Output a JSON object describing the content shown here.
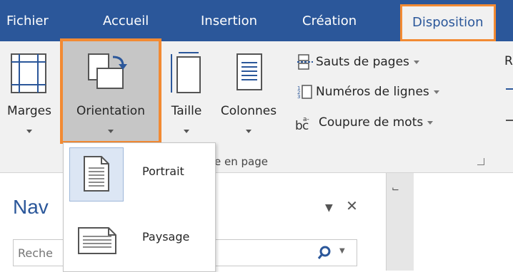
{
  "tabs": [
    {
      "label": "Fichier"
    },
    {
      "label": "Accueil"
    },
    {
      "label": "Insertion"
    },
    {
      "label": "Création"
    },
    {
      "label": "Disposition"
    }
  ],
  "ribbon": {
    "margins_label": "Marges",
    "orientation_label": "Orientation",
    "size_label": "Taille",
    "columns_label": "Colonnes",
    "breaks_label": "Sauts de pages",
    "line_numbers_label": "Numéros de lignes",
    "hyphenation_label": "Coupure de mots",
    "group_label": "e en page",
    "cut_letter": "R"
  },
  "orientation_menu": {
    "items": [
      {
        "label": "Portrait"
      },
      {
        "label": "Paysage"
      }
    ]
  },
  "navigation": {
    "title": "Nav",
    "search_placeholder": "Reche"
  },
  "colors": {
    "tab_bar": "#2b579a",
    "ribbon_bg": "#f1f1f1",
    "highlight_outline": "#f28a33",
    "pressed_button": "#c6c6c6"
  }
}
